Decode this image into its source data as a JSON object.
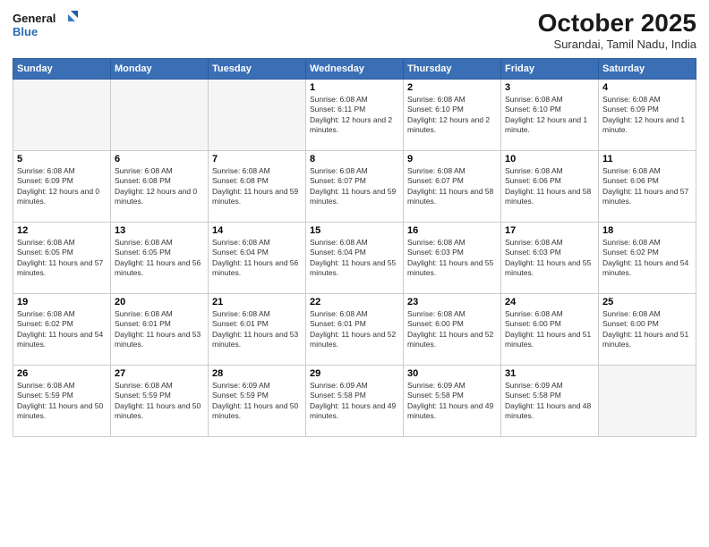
{
  "header": {
    "logo_line1": "General",
    "logo_line2": "Blue",
    "month": "October 2025",
    "location": "Surandai, Tamil Nadu, India"
  },
  "weekdays": [
    "Sunday",
    "Monday",
    "Tuesday",
    "Wednesday",
    "Thursday",
    "Friday",
    "Saturday"
  ],
  "weeks": [
    [
      {
        "day": "",
        "info": ""
      },
      {
        "day": "",
        "info": ""
      },
      {
        "day": "",
        "info": ""
      },
      {
        "day": "1",
        "info": "Sunrise: 6:08 AM\nSunset: 6:11 PM\nDaylight: 12 hours and 2 minutes."
      },
      {
        "day": "2",
        "info": "Sunrise: 6:08 AM\nSunset: 6:10 PM\nDaylight: 12 hours and 2 minutes."
      },
      {
        "day": "3",
        "info": "Sunrise: 6:08 AM\nSunset: 6:10 PM\nDaylight: 12 hours and 1 minute."
      },
      {
        "day": "4",
        "info": "Sunrise: 6:08 AM\nSunset: 6:09 PM\nDaylight: 12 hours and 1 minute."
      }
    ],
    [
      {
        "day": "5",
        "info": "Sunrise: 6:08 AM\nSunset: 6:09 PM\nDaylight: 12 hours and 0 minutes."
      },
      {
        "day": "6",
        "info": "Sunrise: 6:08 AM\nSunset: 6:08 PM\nDaylight: 12 hours and 0 minutes."
      },
      {
        "day": "7",
        "info": "Sunrise: 6:08 AM\nSunset: 6:08 PM\nDaylight: 11 hours and 59 minutes."
      },
      {
        "day": "8",
        "info": "Sunrise: 6:08 AM\nSunset: 6:07 PM\nDaylight: 11 hours and 59 minutes."
      },
      {
        "day": "9",
        "info": "Sunrise: 6:08 AM\nSunset: 6:07 PM\nDaylight: 11 hours and 58 minutes."
      },
      {
        "day": "10",
        "info": "Sunrise: 6:08 AM\nSunset: 6:06 PM\nDaylight: 11 hours and 58 minutes."
      },
      {
        "day": "11",
        "info": "Sunrise: 6:08 AM\nSunset: 6:06 PM\nDaylight: 11 hours and 57 minutes."
      }
    ],
    [
      {
        "day": "12",
        "info": "Sunrise: 6:08 AM\nSunset: 6:05 PM\nDaylight: 11 hours and 57 minutes."
      },
      {
        "day": "13",
        "info": "Sunrise: 6:08 AM\nSunset: 6:05 PM\nDaylight: 11 hours and 56 minutes."
      },
      {
        "day": "14",
        "info": "Sunrise: 6:08 AM\nSunset: 6:04 PM\nDaylight: 11 hours and 56 minutes."
      },
      {
        "day": "15",
        "info": "Sunrise: 6:08 AM\nSunset: 6:04 PM\nDaylight: 11 hours and 55 minutes."
      },
      {
        "day": "16",
        "info": "Sunrise: 6:08 AM\nSunset: 6:03 PM\nDaylight: 11 hours and 55 minutes."
      },
      {
        "day": "17",
        "info": "Sunrise: 6:08 AM\nSunset: 6:03 PM\nDaylight: 11 hours and 55 minutes."
      },
      {
        "day": "18",
        "info": "Sunrise: 6:08 AM\nSunset: 6:02 PM\nDaylight: 11 hours and 54 minutes."
      }
    ],
    [
      {
        "day": "19",
        "info": "Sunrise: 6:08 AM\nSunset: 6:02 PM\nDaylight: 11 hours and 54 minutes."
      },
      {
        "day": "20",
        "info": "Sunrise: 6:08 AM\nSunset: 6:01 PM\nDaylight: 11 hours and 53 minutes."
      },
      {
        "day": "21",
        "info": "Sunrise: 6:08 AM\nSunset: 6:01 PM\nDaylight: 11 hours and 53 minutes."
      },
      {
        "day": "22",
        "info": "Sunrise: 6:08 AM\nSunset: 6:01 PM\nDaylight: 11 hours and 52 minutes."
      },
      {
        "day": "23",
        "info": "Sunrise: 6:08 AM\nSunset: 6:00 PM\nDaylight: 11 hours and 52 minutes."
      },
      {
        "day": "24",
        "info": "Sunrise: 6:08 AM\nSunset: 6:00 PM\nDaylight: 11 hours and 51 minutes."
      },
      {
        "day": "25",
        "info": "Sunrise: 6:08 AM\nSunset: 6:00 PM\nDaylight: 11 hours and 51 minutes."
      }
    ],
    [
      {
        "day": "26",
        "info": "Sunrise: 6:08 AM\nSunset: 5:59 PM\nDaylight: 11 hours and 50 minutes."
      },
      {
        "day": "27",
        "info": "Sunrise: 6:08 AM\nSunset: 5:59 PM\nDaylight: 11 hours and 50 minutes."
      },
      {
        "day": "28",
        "info": "Sunrise: 6:09 AM\nSunset: 5:59 PM\nDaylight: 11 hours and 50 minutes."
      },
      {
        "day": "29",
        "info": "Sunrise: 6:09 AM\nSunset: 5:58 PM\nDaylight: 11 hours and 49 minutes."
      },
      {
        "day": "30",
        "info": "Sunrise: 6:09 AM\nSunset: 5:58 PM\nDaylight: 11 hours and 49 minutes."
      },
      {
        "day": "31",
        "info": "Sunrise: 6:09 AM\nSunset: 5:58 PM\nDaylight: 11 hours and 48 minutes."
      },
      {
        "day": "",
        "info": ""
      }
    ]
  ]
}
